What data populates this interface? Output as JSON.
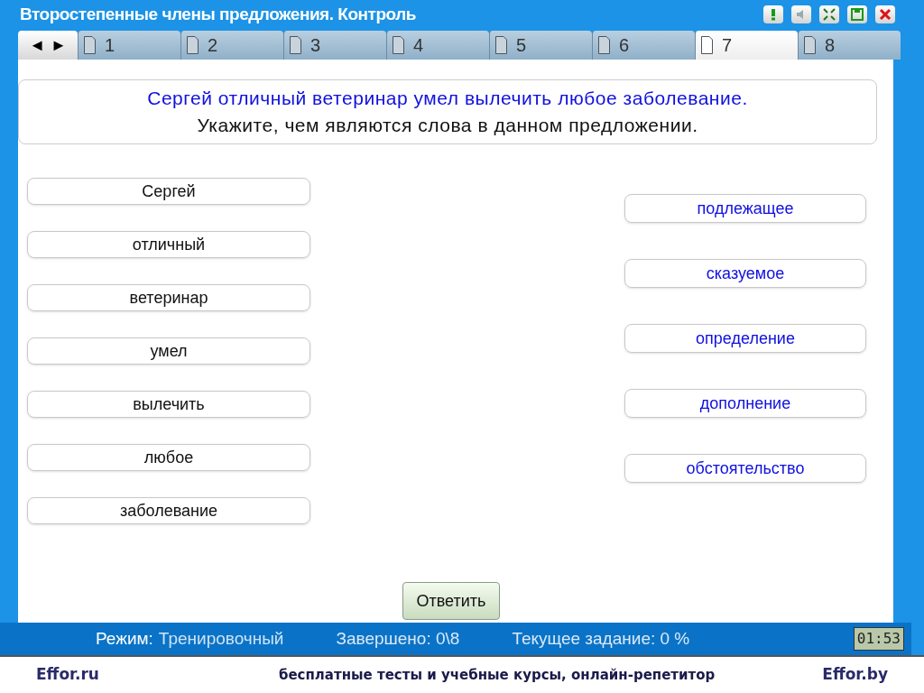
{
  "window": {
    "title": "Второстепенные члены предложения. Контроль"
  },
  "nav": {
    "prev": "◄",
    "next": "►"
  },
  "tabs": [
    {
      "label": "1",
      "selected": false
    },
    {
      "label": "2",
      "selected": false
    },
    {
      "label": "3",
      "selected": false
    },
    {
      "label": "4",
      "selected": false
    },
    {
      "label": "5",
      "selected": false
    },
    {
      "label": "6",
      "selected": false
    },
    {
      "label": "7",
      "selected": true
    },
    {
      "label": "8",
      "selected": false
    }
  ],
  "question": {
    "sentence": "Сергей отличный ветеринар умел вылечить любое заболевание.",
    "instruction": "Укажите, чем являются слова в данном предложении."
  },
  "words": [
    "Сергей",
    "отличный",
    "ветеринар",
    "умел",
    "вылечить",
    "любое",
    "заболевание"
  ],
  "answers": [
    "подлежащее",
    "сказуемое",
    "определение",
    "дополнение",
    "обстоятельство"
  ],
  "submit": "Ответить",
  "status": {
    "mode_label": "Режим:",
    "mode": "Тренировочный",
    "done": "Завершено: 0\\8",
    "current": "Текущее задание: 0 %",
    "timer": "01:53"
  },
  "footer": {
    "left": "Effor.ru",
    "center": "бесплатные тесты и учебные курсы, онлайн-репетитор",
    "right": "Effor.by"
  }
}
